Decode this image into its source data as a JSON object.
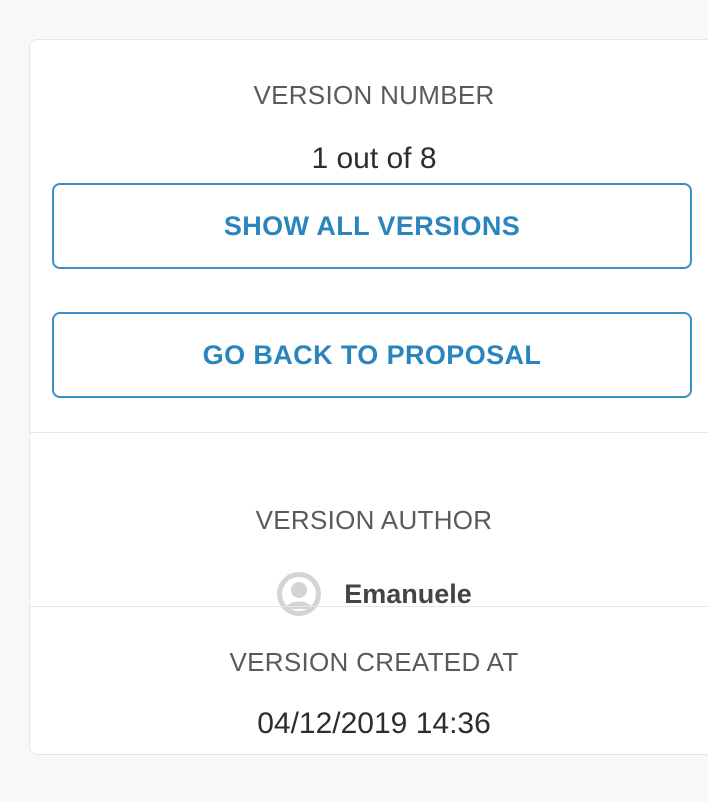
{
  "version": {
    "caption": "VERSION NUMBER",
    "value": "1 out of 8",
    "show_all_label": "SHOW ALL VERSIONS",
    "go_back_label": "GO BACK TO PROPOSAL"
  },
  "author": {
    "caption": "VERSION AUTHOR",
    "name": "Emanuele",
    "avatar_icon": "user-avatar-icon"
  },
  "created": {
    "caption": "VERSION CREATED AT",
    "value": "04/12/2019 14:36"
  },
  "colors": {
    "accent": "#2a85bf",
    "border": "#e6e6e6",
    "background": "#f8f8f8"
  }
}
